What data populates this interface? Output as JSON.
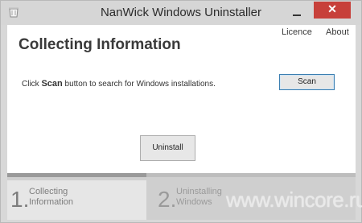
{
  "window": {
    "title": "NanWick Windows Uninstaller",
    "close_glyph": "✕"
  },
  "header": {
    "heading": "Collecting Information",
    "links": {
      "licence": "Licence",
      "about": "About"
    }
  },
  "instructions": {
    "before": "Click ",
    "keyword": "Scan",
    "after": " button to search for Windows installations."
  },
  "buttons": {
    "scan": "Scan",
    "uninstall": "Uninstall"
  },
  "steps": [
    {
      "number": "1.",
      "line1": "Collecting",
      "line2": "Information",
      "active": true
    },
    {
      "number": "2.",
      "line1": "Uninstalling",
      "line2": "Windows",
      "active": false
    }
  ],
  "watermark": "www.wincore.ru",
  "colors": {
    "close": "#c7403a",
    "scan_border": "#3c7fb1",
    "background": "#d8d8d8"
  },
  "icons": {
    "app": "recycle-bin-icon",
    "minimize": "minimize-icon",
    "close": "close-icon"
  }
}
